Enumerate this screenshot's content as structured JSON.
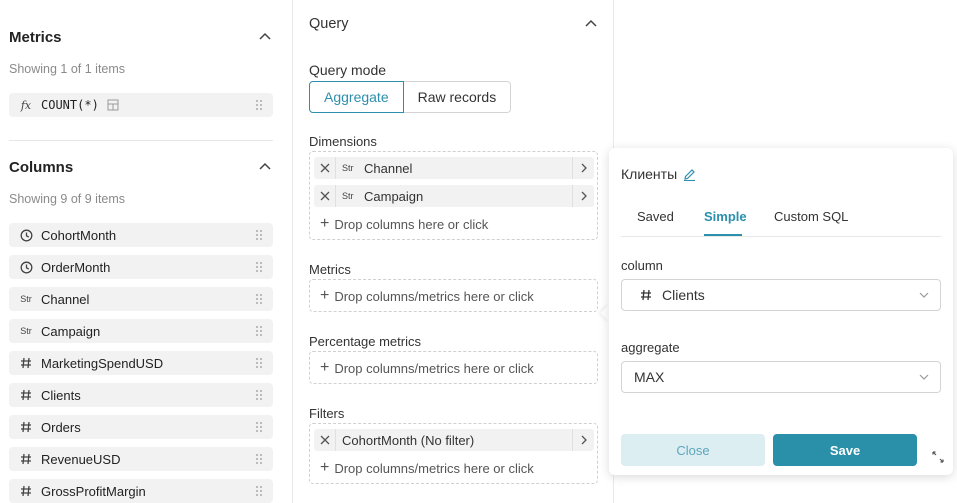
{
  "metrics": {
    "title": "Metrics",
    "count_text": "Showing 1 of 1 items",
    "items": [
      {
        "label": "COUNT(*)",
        "icon": "fx"
      }
    ]
  },
  "columns": {
    "title": "Columns",
    "count_text": "Showing 9 of 9 items",
    "items": [
      {
        "label": "CohortMonth",
        "icon": "clock-icon"
      },
      {
        "label": "OrderMonth",
        "icon": "clock-icon"
      },
      {
        "label": "Channel",
        "icon": "Str"
      },
      {
        "label": "Campaign",
        "icon": "Str"
      },
      {
        "label": "MarketingSpendUSD",
        "icon": "#"
      },
      {
        "label": "Clients",
        "icon": "#"
      },
      {
        "label": "Orders",
        "icon": "#"
      },
      {
        "label": "RevenueUSD",
        "icon": "#"
      },
      {
        "label": "GrossProfitMargin",
        "icon": "#"
      }
    ]
  },
  "query": {
    "title": "Query",
    "mode_label": "Query mode",
    "modes": [
      "Aggregate",
      "Raw records"
    ],
    "dimensions_label": "Dimensions",
    "dimensions": [
      {
        "type": "Str",
        "label": "Channel"
      },
      {
        "type": "Str",
        "label": "Campaign"
      }
    ],
    "dimensions_drop": "Drop columns here or click",
    "metrics_label": "Metrics",
    "metrics_drop": "Drop columns/metrics here or click",
    "pct_label": "Percentage metrics",
    "pct_drop": "Drop columns/metrics here or click",
    "filters_label": "Filters",
    "filters": [
      {
        "label": "CohortMonth (No filter)"
      }
    ],
    "filters_drop": "Drop columns/metrics here or click"
  },
  "popover": {
    "title": "Клиенты",
    "tabs": [
      "Saved",
      "Simple",
      "Custom SQL"
    ],
    "active_tab": "Simple",
    "column_label": "column",
    "column_value": "Clients",
    "aggregate_label": "aggregate",
    "aggregate_value": "MAX",
    "close_label": "Close",
    "save_label": "Save"
  },
  "colors": {
    "accent": "#2c8fad",
    "save_bg": "#2a8fa9",
    "close_bg": "#dceef2"
  }
}
